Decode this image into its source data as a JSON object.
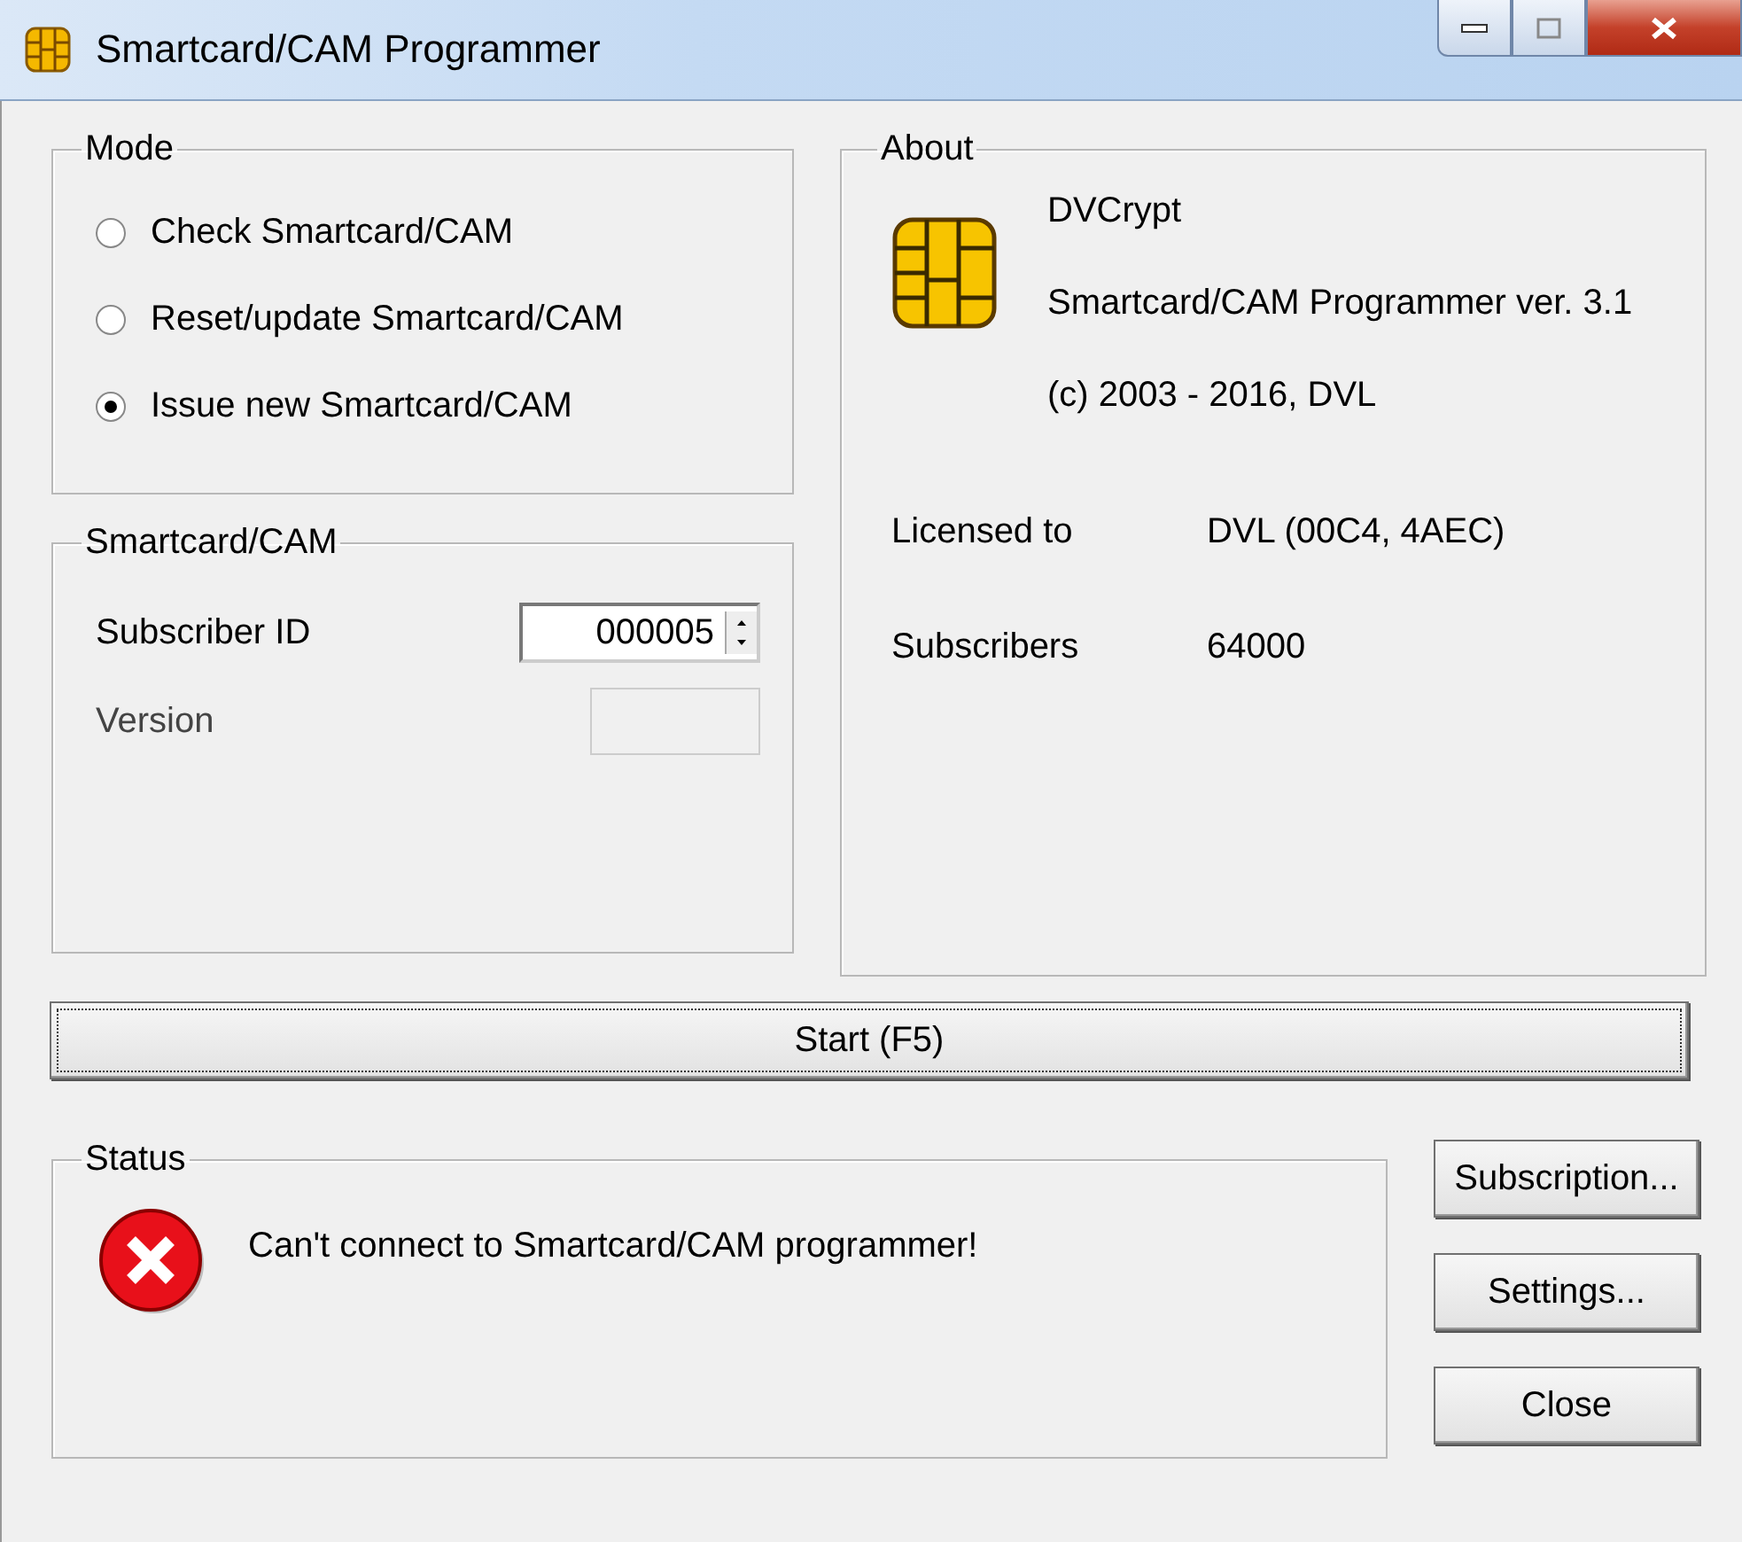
{
  "window": {
    "title": "Smartcard/CAM Programmer"
  },
  "mode": {
    "title": "Mode",
    "options": [
      {
        "label": "Check Smartcard/CAM",
        "selected": false
      },
      {
        "label": "Reset/update Smartcard/CAM",
        "selected": false
      },
      {
        "label": "Issue new Smartcard/CAM",
        "selected": true
      }
    ]
  },
  "smartcard": {
    "title": "Smartcard/CAM",
    "subscriber_id": {
      "label": "Subscriber ID",
      "value": "000005"
    },
    "version": {
      "label": "Version",
      "disabled": true
    }
  },
  "about": {
    "title": "About",
    "lines": [
      "DVCrypt",
      "Smartcard/CAM Programmer ver. 3.1",
      "(c) 2003 - 2016, DVL"
    ],
    "info": [
      {
        "label": "Licensed to",
        "value": "DVL (00C4, 4AEC)"
      },
      {
        "label": "Subscribers",
        "value": "64000"
      }
    ]
  },
  "start_button": "Start (F5)",
  "status": {
    "title": "Status",
    "message": "Can't connect to Smartcard/CAM programmer!"
  },
  "buttons": [
    "Subscription...",
    "Settings...",
    "Close"
  ]
}
